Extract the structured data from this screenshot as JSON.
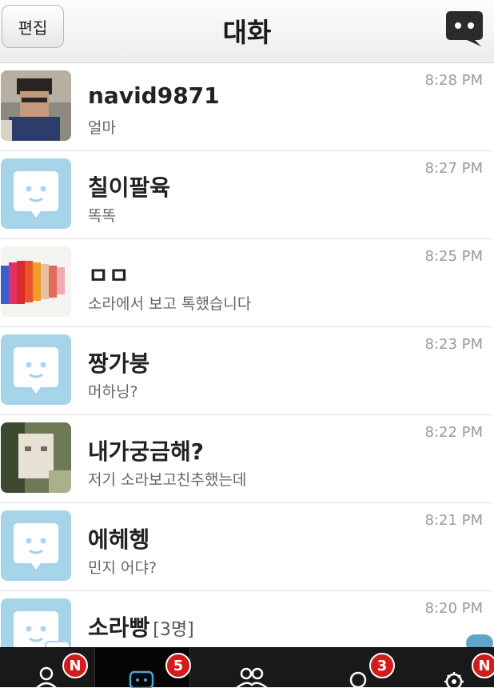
{
  "header": {
    "edit_label": "편집",
    "title": "대화",
    "compose_icon": "chat-bubble-icon"
  },
  "chats": [
    {
      "name": "navid9871",
      "message": "얼마",
      "time": "8:28 PM",
      "avatar": "photo"
    },
    {
      "name": "칠이팔육",
      "message": "똑똑",
      "time": "8:27 PM",
      "avatar": "default"
    },
    {
      "name": "ㅁㅁ",
      "message": "소라에서 보고 톡했습니다",
      "time": "8:25 PM",
      "avatar": "paint"
    },
    {
      "name": "짱가붕",
      "message": "머하닝?",
      "time": "8:23 PM",
      "avatar": "default"
    },
    {
      "name": "내가궁금해?",
      "message": "저기 소라보고친추했는데",
      "time": "8:22 PM",
      "avatar": "photo2"
    },
    {
      "name": "에헤헹",
      "message": "민지 어댜?",
      "time": "8:21 PM",
      "avatar": "default"
    },
    {
      "name": "소라빵",
      "count": "[3명]",
      "message": "",
      "time": "8:20 PM",
      "avatar": "group"
    }
  ],
  "tabs": [
    {
      "icon": "friend-icon",
      "badge": "N"
    },
    {
      "icon": "chat-icon",
      "badge": "5"
    },
    {
      "icon": "group-icon",
      "badge": ""
    },
    {
      "icon": "search-icon",
      "badge": "3"
    },
    {
      "icon": "gear-icon",
      "badge": "N"
    }
  ],
  "colors": {
    "avatar_bg": "#a6d4e9",
    "badge": "#d41b1b",
    "tabbar": "#191919"
  }
}
